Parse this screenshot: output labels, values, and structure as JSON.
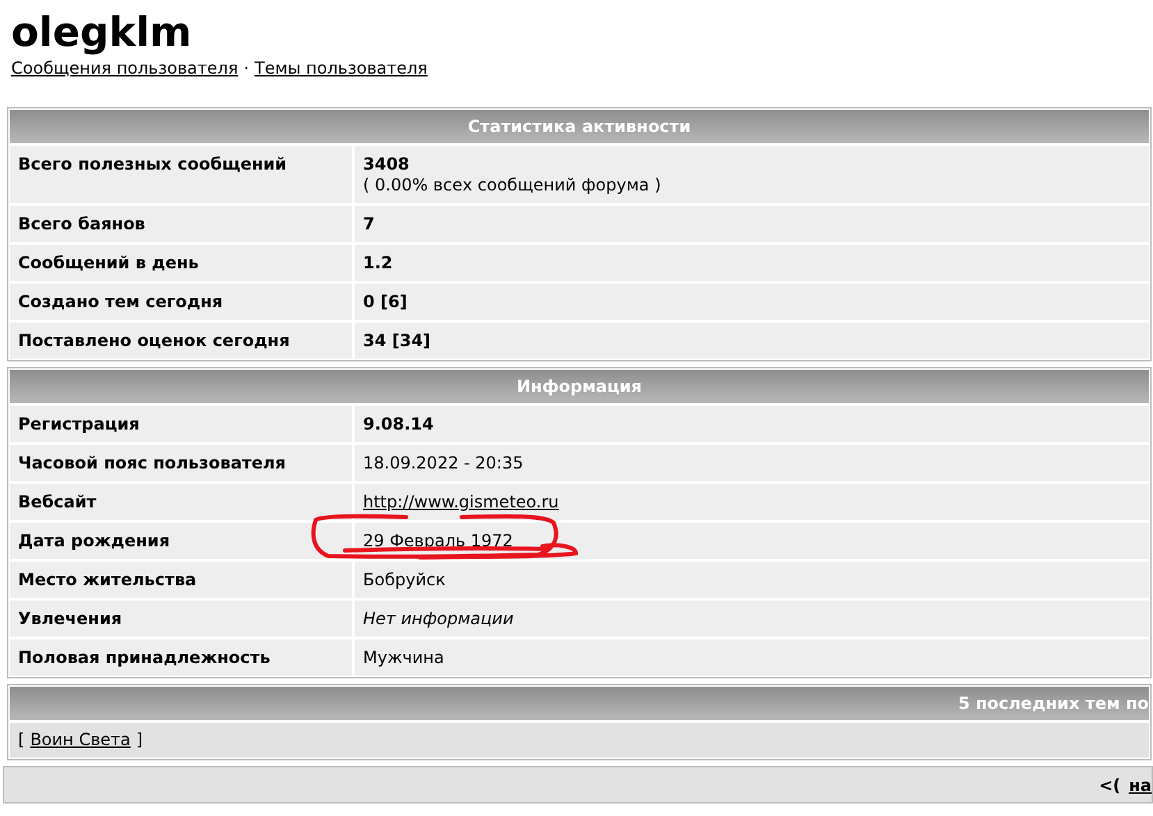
{
  "profile": {
    "name": "olegklm",
    "links": [
      "Сообщения пользователя",
      "Темы пользователя"
    ],
    "separator": "·"
  },
  "sections": [
    {
      "title": "Статистика активности",
      "rows": [
        {
          "label": "Всего полезных сообщений",
          "kind": "bold",
          "value": "3408",
          "note": "( 0.00% всех сообщений форума )"
        },
        {
          "label": "Всего баянов",
          "kind": "bold",
          "value": "7"
        },
        {
          "label": "Сообщений в день",
          "kind": "bold",
          "value": "1.2"
        },
        {
          "label": "Создано тем сегодня",
          "kind": "bold",
          "value": "0 [6]"
        },
        {
          "label": "Поставлено оценок сегодня",
          "kind": "bold",
          "value": "34 [34]"
        }
      ]
    },
    {
      "title": "Информация",
      "rows": [
        {
          "label": "Регистрация",
          "kind": "bold",
          "value": "9.08.14"
        },
        {
          "label": "Часовой пояс пользователя",
          "kind": "text",
          "value": "18.09.2022 - 20:35"
        },
        {
          "label": "Вебсайт",
          "kind": "link",
          "value": "http://www.gismeteo.ru"
        },
        {
          "label": "Дата рождения",
          "kind": "text",
          "value": "29 Февраль 1972"
        },
        {
          "label": "Место жительства",
          "kind": "text",
          "value": "Бобруйск"
        },
        {
          "label": "Увлечения",
          "kind": "italic",
          "value": "Нет информации"
        },
        {
          "label": "Половая принадлежность",
          "kind": "text",
          "value": "Мужчина"
        }
      ]
    }
  ],
  "topics": {
    "title": "5 последних тем по",
    "open": "[",
    "items": [
      "Воин Света"
    ],
    "close": "]"
  },
  "footer": {
    "prefix": "<(",
    "link": "на"
  },
  "annotation": {
    "kind": "scribble"
  }
}
